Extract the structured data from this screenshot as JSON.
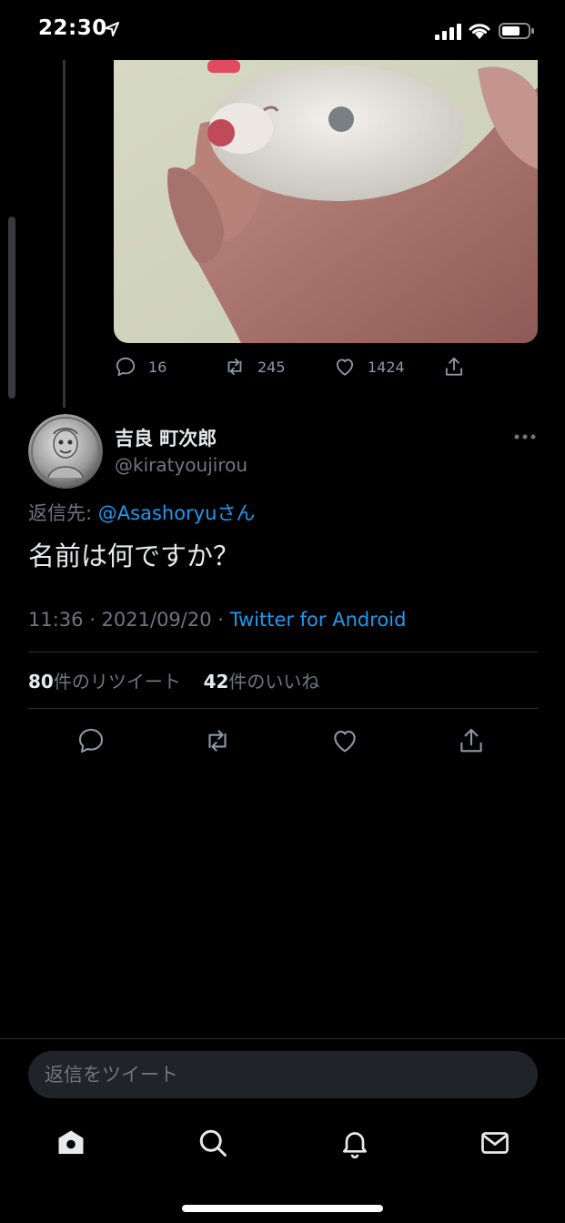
{
  "status_bar": {
    "time": "22:30"
  },
  "parent_tweet": {
    "actions": {
      "replies": "16",
      "retweets": "245",
      "likes": "1424"
    }
  },
  "tweet": {
    "display_name": "吉良 町次郎",
    "handle": "@kiratyoujirou",
    "reply_label": "返信先: ",
    "reply_mention": "@Asashoryuさん",
    "text": "名前は何ですか？",
    "timestamp": "11:36 · 2021/09/20 · ",
    "source": "Twitter for Android",
    "retweet_count": "80",
    "retweet_label": "件のリツイート",
    "like_count": "42",
    "like_label": "件のいいね"
  },
  "reply_bar": {
    "placeholder": "返信をツイート"
  },
  "colors": {
    "accent": "#1d9bf0",
    "background": "#000000",
    "muted": "#71767b"
  }
}
